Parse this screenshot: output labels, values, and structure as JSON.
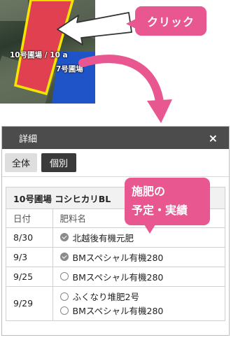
{
  "map": {
    "label_line1": "10号圃場 / 10 a",
    "label_line2": "7号圃場"
  },
  "callouts": {
    "click": "クリック",
    "fertilizer_line1": "施肥の",
    "fertilizer_line2": "予定・実績"
  },
  "panel": {
    "title": "詳細",
    "close_label": "×",
    "tabs": [
      {
        "label": "全体",
        "active": false
      },
      {
        "label": "個別",
        "active": true
      }
    ],
    "field_name": "10号圃場 コシヒカリBL",
    "table": {
      "headers": [
        "日付",
        "肥料名"
      ],
      "rows": [
        {
          "date": "8/30",
          "items": [
            {
              "name": "北越後有機元肥",
              "done": true
            }
          ]
        },
        {
          "date": "9/3",
          "items": [
            {
              "name": "BMスペシャル有機280",
              "done": true
            }
          ]
        },
        {
          "date": "9/25",
          "items": [
            {
              "name": "BMスペシャル有機280",
              "done": false
            }
          ]
        },
        {
          "date": "9/29",
          "items": [
            {
              "name": "ふくなり堆肥2号",
              "done": false
            },
            {
              "name": "BMスペシャル有機280",
              "done": false
            }
          ]
        }
      ]
    }
  },
  "colors": {
    "accent_pink": "#e8578f",
    "field_red": "#e0404f",
    "field_outline_yellow": "#f5e600",
    "panel_header": "#4c4c4c"
  }
}
